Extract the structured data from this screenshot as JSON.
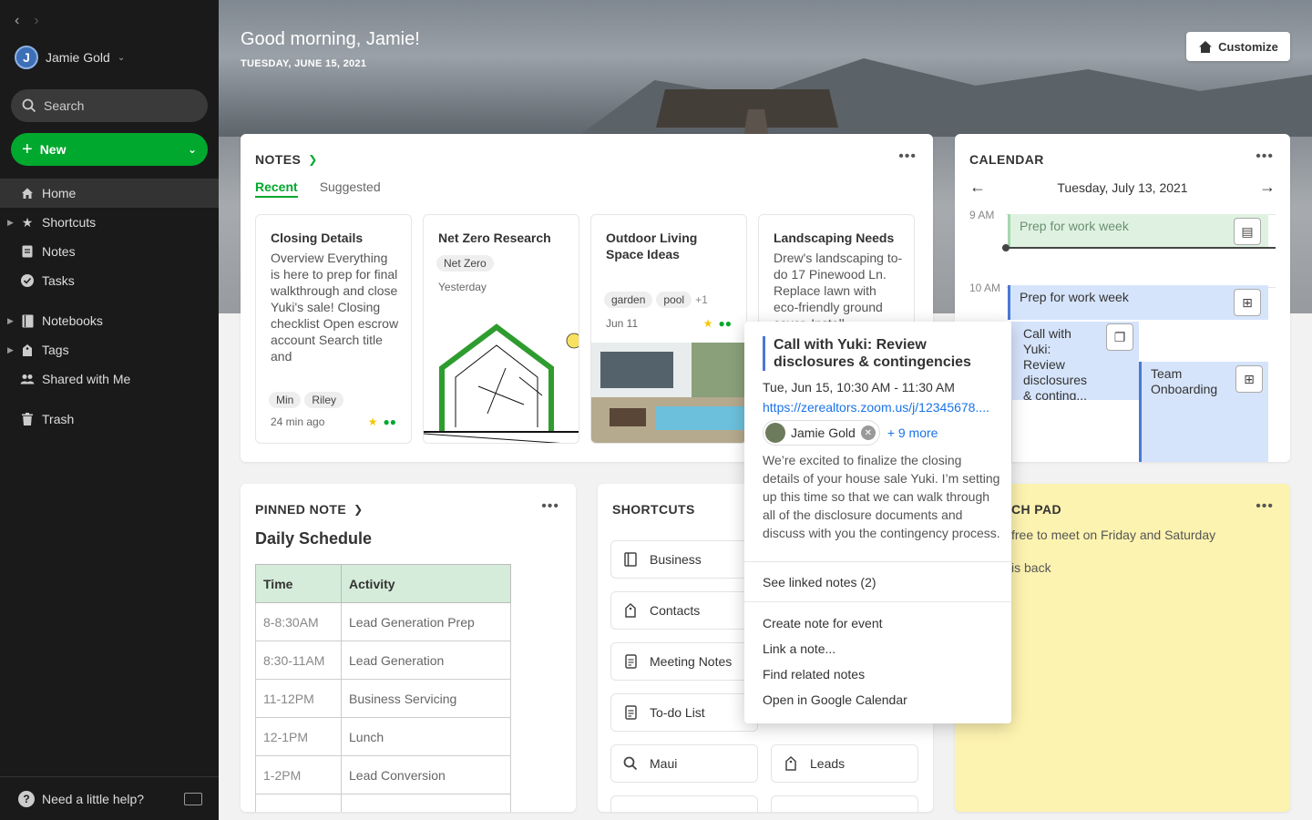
{
  "sidebar": {
    "account_name": "Jamie Gold",
    "account_initial": "J",
    "search_placeholder": "Search",
    "new_label": "New",
    "items": [
      {
        "label": "Home",
        "icon": "home-icon"
      },
      {
        "label": "Shortcuts",
        "icon": "star-icon"
      },
      {
        "label": "Notes",
        "icon": "notes-icon"
      },
      {
        "label": "Tasks",
        "icon": "check-circle-icon"
      },
      {
        "label": "Notebooks",
        "icon": "notebook-icon"
      },
      {
        "label": "Tags",
        "icon": "tag-icon"
      },
      {
        "label": "Shared with Me",
        "icon": "people-icon"
      },
      {
        "label": "Trash",
        "icon": "trash-icon"
      }
    ],
    "help_label": "Need a little help?"
  },
  "hero": {
    "greeting": "Good morning, Jamie!",
    "date": "TUESDAY, JUNE 15, 2021",
    "customize_label": "Customize"
  },
  "notes": {
    "title": "NOTES",
    "tabs": [
      "Recent",
      "Suggested"
    ],
    "cards": [
      {
        "title": "Closing Details",
        "body": "Overview Everything is here to prep for final walkthrough and close Yuki's sale! Closing checklist Open escrow account Search title and",
        "tags": [
          "Min",
          "Riley"
        ],
        "meta": "24 min ago"
      },
      {
        "title": "Net Zero Research",
        "tags": [
          "Net Zero"
        ],
        "meta": "Yesterday"
      },
      {
        "title": "Outdoor Living Space Ideas",
        "tags": [
          "garden",
          "pool"
        ],
        "extra_tags": "+1",
        "meta": "Jun 11"
      },
      {
        "title": "Landscaping Needs",
        "body": "Drew's landscaping to-do 17 Pinewood Ln. Replace lawn with eco-friendly ground cover. Install"
      }
    ]
  },
  "calendar": {
    "title": "CALENDAR",
    "date": "Tuesday, July 13, 2021",
    "hours": [
      "9 AM",
      "10 AM"
    ],
    "events": [
      {
        "title": "Prep for work week"
      },
      {
        "title": "Prep for work week"
      },
      {
        "title": "Call with Yuki: Review disclosures & conting..."
      },
      {
        "title": "Team Onboarding"
      }
    ]
  },
  "popover": {
    "title": "Call with Yuki: Review disclosures & contingencies",
    "time": "Tue, Jun 15, 10:30 AM - 11:30 AM",
    "link": "https://zerealtors.zoom.us/j/12345678....",
    "attendee": "Jamie Gold",
    "more": "+ 9 more",
    "description": "We’re excited to finalize the closing details of your house sale Yuki. I’m setting up this time so that we can walk through all of the disclosure documents and discuss with you the contingency process.",
    "linked_notes": "See linked notes (2)",
    "menu": [
      "Create note for event",
      "Link a note...",
      "Find related notes",
      "Open in Google Calendar"
    ]
  },
  "pinned": {
    "title": "PINNED NOTE",
    "note_title": "Daily Schedule",
    "headers": [
      "Time",
      "Activity"
    ],
    "rows": [
      [
        "8-8:30AM",
        "Lead Generation Prep"
      ],
      [
        "8:30-11AM",
        "Lead Generation"
      ],
      [
        "11-12PM",
        "Business Servicing"
      ],
      [
        "12-1PM",
        "Lunch"
      ],
      [
        "1-2PM",
        "Lead Conversion"
      ]
    ]
  },
  "shortcuts": {
    "title": "SHORTCUTS",
    "items": [
      {
        "label": "Business",
        "icon": "notebook-icon"
      },
      {
        "label": "Contacts",
        "icon": "tag-icon"
      },
      {
        "label": "Meeting Notes",
        "icon": "note-icon"
      },
      {
        "label": "To-do List",
        "icon": "note-icon"
      },
      {
        "label": "Maui",
        "icon": "search-icon"
      },
      {
        "label": "Leads",
        "icon": "tag-icon"
      }
    ]
  },
  "scratch": {
    "title": "CH PAD",
    "lines": [
      "free to meet on Friday and Saturday",
      "is back"
    ]
  }
}
